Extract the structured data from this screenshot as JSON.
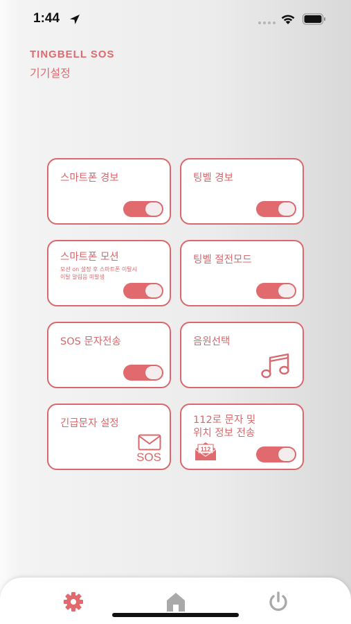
{
  "status_bar": {
    "time": "1:44",
    "icons": [
      "location-arrow-icon",
      "signal-dots-icon",
      "wifi-icon",
      "battery-icon"
    ]
  },
  "header": {
    "brand": "TINGBELL SOS",
    "title": "기기설정"
  },
  "colors": {
    "accent": "#e06a6e",
    "card_border": "#d9676b",
    "background": "#ececec"
  },
  "cards": {
    "smartphone_alarm": {
      "title": "스마트폰 경보",
      "toggle_on": true
    },
    "tingbell_alarm": {
      "title": "팅벨 경보",
      "toggle_on": true
    },
    "smartphone_motion": {
      "title": "스마트폰 모션",
      "subtitle_line1": "모션 on 설정 후 스마트폰 이탈시",
      "subtitle_line2": "이탈 알림음 미발생",
      "toggle_on": true
    },
    "tingbell_power_saving": {
      "title": "팅벨 절전모드",
      "toggle_on": true
    },
    "sos_sms": {
      "title": "SOS 문자전송",
      "toggle_on": true
    },
    "sound_select": {
      "title": "음원선택",
      "icon": "music-note-icon"
    },
    "emergency_sms_setting": {
      "title": "긴급문자 설정",
      "icon": "mail-icon",
      "icon_text": "SOS"
    },
    "sms_112": {
      "title_line1": "112로 문자 및",
      "title_line2": "위치 정보 전송",
      "icon": "mail-112-icon",
      "icon_text": "112",
      "toggle_on": true
    }
  },
  "tab_bar": {
    "tabs": [
      {
        "name": "settings",
        "icon": "gear-icon",
        "active": true
      },
      {
        "name": "home",
        "icon": "home-icon",
        "active": false
      },
      {
        "name": "power",
        "icon": "power-icon",
        "active": false
      }
    ]
  }
}
